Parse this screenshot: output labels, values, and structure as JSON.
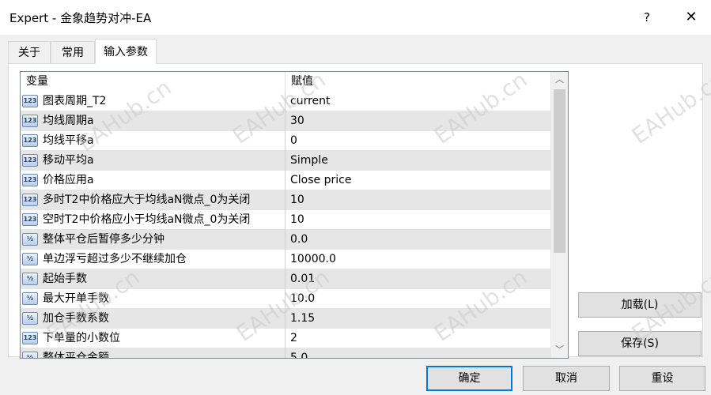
{
  "window": {
    "title": "Expert - 金象趋势对冲-EA",
    "help_glyph": "?",
    "close_glyph": "✕"
  },
  "tabs": [
    {
      "label": "关于"
    },
    {
      "label": "常用"
    },
    {
      "label": "输入参数"
    }
  ],
  "list": {
    "col_variable": "变量",
    "col_value": "赋值",
    "rows": [
      {
        "icon": "123",
        "name": "图表周期_T2",
        "value": "current"
      },
      {
        "icon": "123",
        "name": "均线周期a",
        "value": "30"
      },
      {
        "icon": "123",
        "name": "均线平移a",
        "value": "0"
      },
      {
        "icon": "123",
        "name": "移动平均a",
        "value": "Simple"
      },
      {
        "icon": "123",
        "name": "价格应用a",
        "value": "Close price"
      },
      {
        "icon": "123",
        "name": "多时T2中价格应大于均线aN微点_0为关闭",
        "value": "10"
      },
      {
        "icon": "123",
        "name": "空时T2中价格应小于均线aN微点_0为关闭",
        "value": "10"
      },
      {
        "icon": "½",
        "name": "整体平仓后暂停多少分钟",
        "value": "0.0"
      },
      {
        "icon": "½",
        "name": "单边浮亏超过多少不继续加仓",
        "value": "10000.0"
      },
      {
        "icon": "½",
        "name": "起始手数",
        "value": "0.01"
      },
      {
        "icon": "½",
        "name": "最大开单手数",
        "value": "10.0"
      },
      {
        "icon": "½",
        "name": "加仓手数系数",
        "value": "1.15"
      },
      {
        "icon": "123",
        "name": "下单量的小数位",
        "value": "2"
      },
      {
        "icon": "½",
        "name": "整体平仓金额",
        "value": "5.0"
      }
    ],
    "scroll_up_glyph": "︿",
    "scroll_down_glyph": "﹀"
  },
  "side_buttons": {
    "load_label": "加载(L)",
    "save_label": "保存(S)"
  },
  "footer_buttons": {
    "ok_label": "确定",
    "cancel_label": "取消",
    "reset_label": "重设"
  },
  "watermark": {
    "text": "EAHub.cn"
  }
}
